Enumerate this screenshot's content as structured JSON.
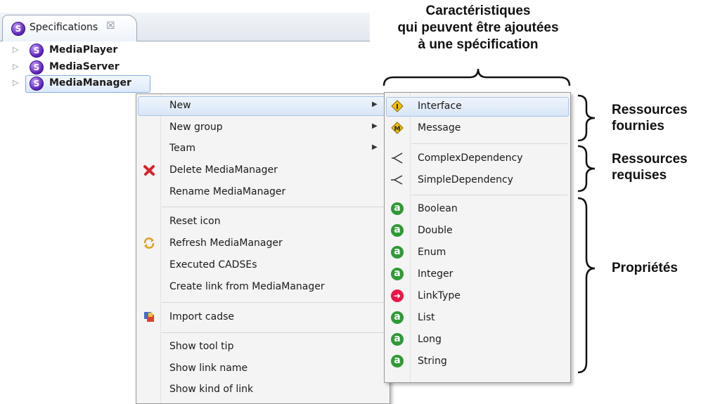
{
  "view_tab": {
    "title": "Specifications",
    "close_glyph": "☒",
    "icon": "specification-s-icon"
  },
  "tree": {
    "items": [
      {
        "label": "MediaPlayer",
        "icon_letter": "S"
      },
      {
        "label": "MediaServer",
        "icon_letter": "S"
      },
      {
        "label": "MediaManager",
        "icon_letter": "S"
      }
    ],
    "selected": "MediaManager"
  },
  "context_menu": {
    "items": [
      {
        "label": "New",
        "submenu": true
      },
      {
        "label": "New group",
        "submenu": true
      },
      {
        "label": "Team",
        "submenu": true
      },
      {
        "label": "Delete MediaManager",
        "icon": "delete-x-icon"
      },
      {
        "label": "Rename MediaManager"
      },
      {
        "label": "Reset icon"
      },
      {
        "label": "Refresh MediaManager",
        "icon": "refresh-icon"
      },
      {
        "label": "Executed CADSEs"
      },
      {
        "label": "Create link from MediaManager"
      },
      {
        "label": "Import cadse",
        "icon": "import-icon"
      },
      {
        "label": "Show tool tip"
      },
      {
        "label": "Show link name"
      },
      {
        "label": "Show kind of link"
      }
    ],
    "highlighted": "New"
  },
  "new_submenu": {
    "items": [
      {
        "label": "Interface",
        "icon": "interface-i-icon"
      },
      {
        "label": "Message",
        "icon": "message-m-icon"
      },
      {
        "label": "ComplexDependency",
        "icon": "dependency-icon"
      },
      {
        "label": "SimpleDependency",
        "icon": "dependency-icon"
      },
      {
        "label": "Boolean",
        "icon": "attribute-a-icon"
      },
      {
        "label": "Double",
        "icon": "attribute-a-icon"
      },
      {
        "label": "Enum",
        "icon": "attribute-a-icon"
      },
      {
        "label": "Integer",
        "icon": "attribute-a-icon"
      },
      {
        "label": "LinkType",
        "icon": "link-type-icon"
      },
      {
        "label": "List",
        "icon": "attribute-a-icon"
      },
      {
        "label": "Long",
        "icon": "attribute-a-icon"
      },
      {
        "label": "String",
        "icon": "attribute-a-icon"
      }
    ],
    "highlighted": "Interface"
  },
  "annotations": {
    "top_line1": "Caractéristiques",
    "top_line2": "qui peuvent être ajoutées",
    "top_line3": "à une spécification",
    "provided_line1": "Ressources",
    "provided_line2": "fournies",
    "required_line1": "Ressources",
    "required_line2": "requises",
    "properties": "Propriétés"
  },
  "colors": {
    "spec_icon": "#5a1fb8",
    "attribute_icon": "#2f9a37",
    "link_icon": "#e8174a",
    "interface_icon": "#e8b400",
    "highlight": "#d9e6f7"
  }
}
